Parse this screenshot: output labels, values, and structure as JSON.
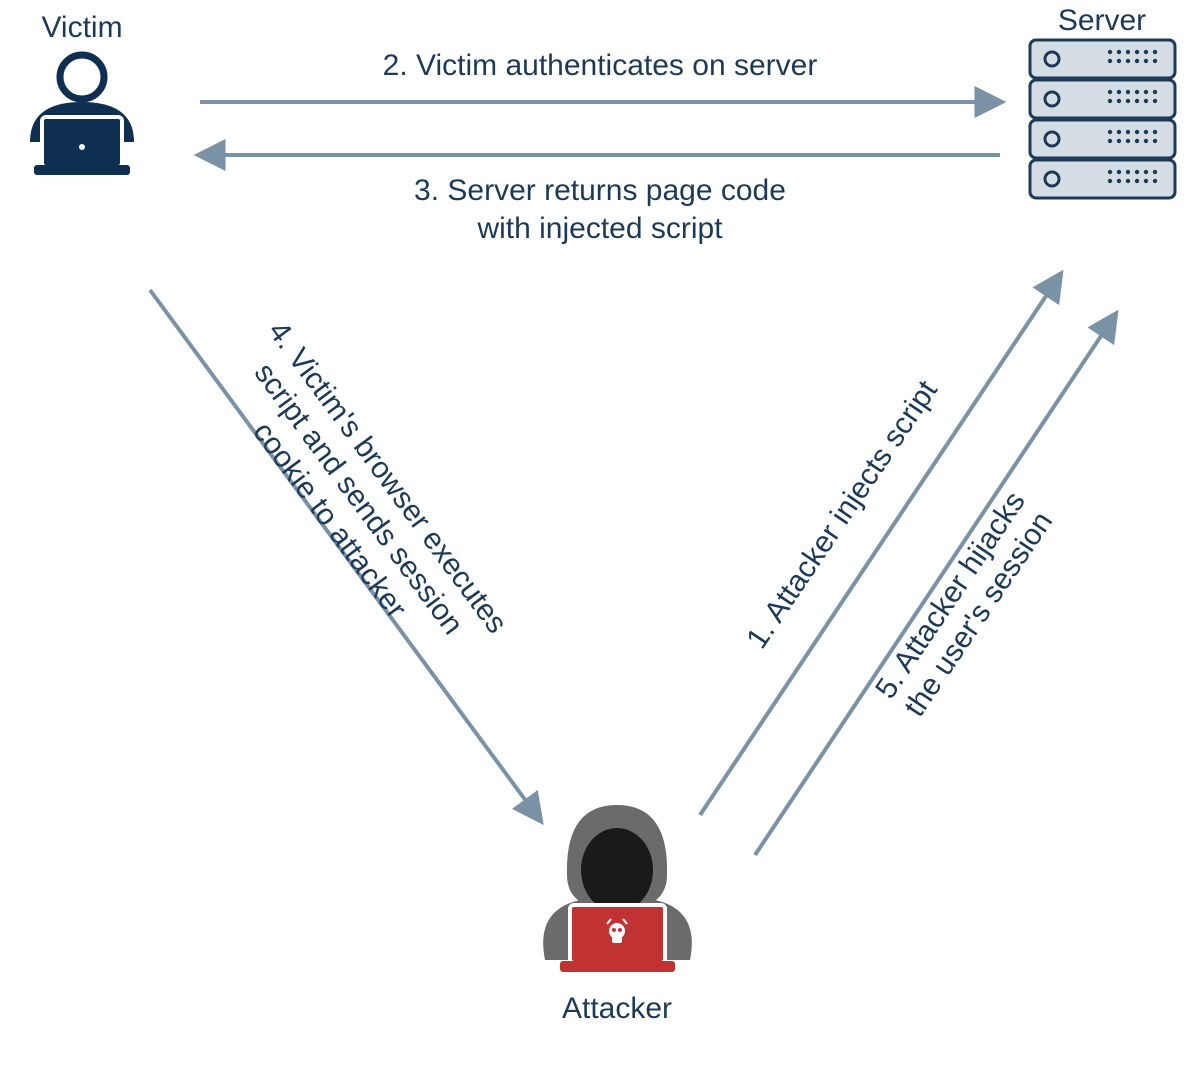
{
  "colors": {
    "text": "#1c3a57",
    "arrow": "#7a92a6",
    "navy": "#0e2f4f",
    "attacker_grey": "#6b6b6b",
    "attacker_dark": "#1a1a1a",
    "attacker_red": "#c13232",
    "server_fill": "#d5dde4",
    "server_stroke": "#1c3a57"
  },
  "nodes": {
    "victim": {
      "label": "Victim"
    },
    "server": {
      "label": "Server"
    },
    "attacker": {
      "label": "Attacker"
    }
  },
  "steps": {
    "s1": "1. Attacker injects script",
    "s2": "2. Victim authenticates on server",
    "s3a": "3. Server returns page code",
    "s3b": "with injected script",
    "s4a": "4. Victim's browser executes",
    "s4b": "script and sends session",
    "s4c": "cookie to attacker",
    "s5a": "5. Attacker hijacks",
    "s5b": "the user's session"
  }
}
